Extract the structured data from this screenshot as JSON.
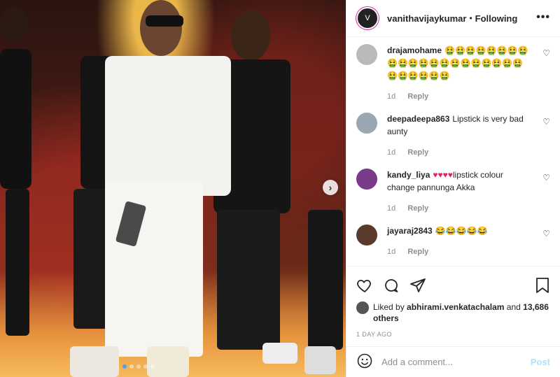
{
  "header": {
    "username": "vanithavijaykumar",
    "separator": "•",
    "follow_status": "Following",
    "more_label": "•••"
  },
  "comments": [
    {
      "username": "drajamohame",
      "text": "🤮🤮🤮🤮🤮🤮🤮🤮🤮🤮🤮🤮🤮🤮🤮🤮🤮🤮🤮🤮🤮🤮🤮🤮🤮🤮🤮",
      "time": "1d",
      "reply": "Reply"
    },
    {
      "username": "deepadeepa863",
      "text": "Lipstick is very bad aunty",
      "time": "1d",
      "reply": "Reply"
    },
    {
      "username": "kandy_liya",
      "text_hearts": "♥♥♥♥",
      "text": "lipstick colour change pannunga Akka",
      "time": "1d",
      "reply": "Reply"
    },
    {
      "username": "jayaraj2843",
      "text": "😂😂😂😂😂",
      "time": "1d",
      "reply": "Reply"
    }
  ],
  "likes": {
    "prefix": "Liked by",
    "user": "abhirami.venkatachalam",
    "and": "and",
    "others": "13,686 others"
  },
  "time_ago": "1 DAY AGO",
  "add_comment": {
    "placeholder": "Add a comment...",
    "post_label": "Post"
  },
  "carousel": {
    "next_label": "›"
  },
  "colors": {
    "heart_red": "#e0245e",
    "post_disabled": "#b2dffc",
    "meta_gray": "#8e8e8e"
  }
}
